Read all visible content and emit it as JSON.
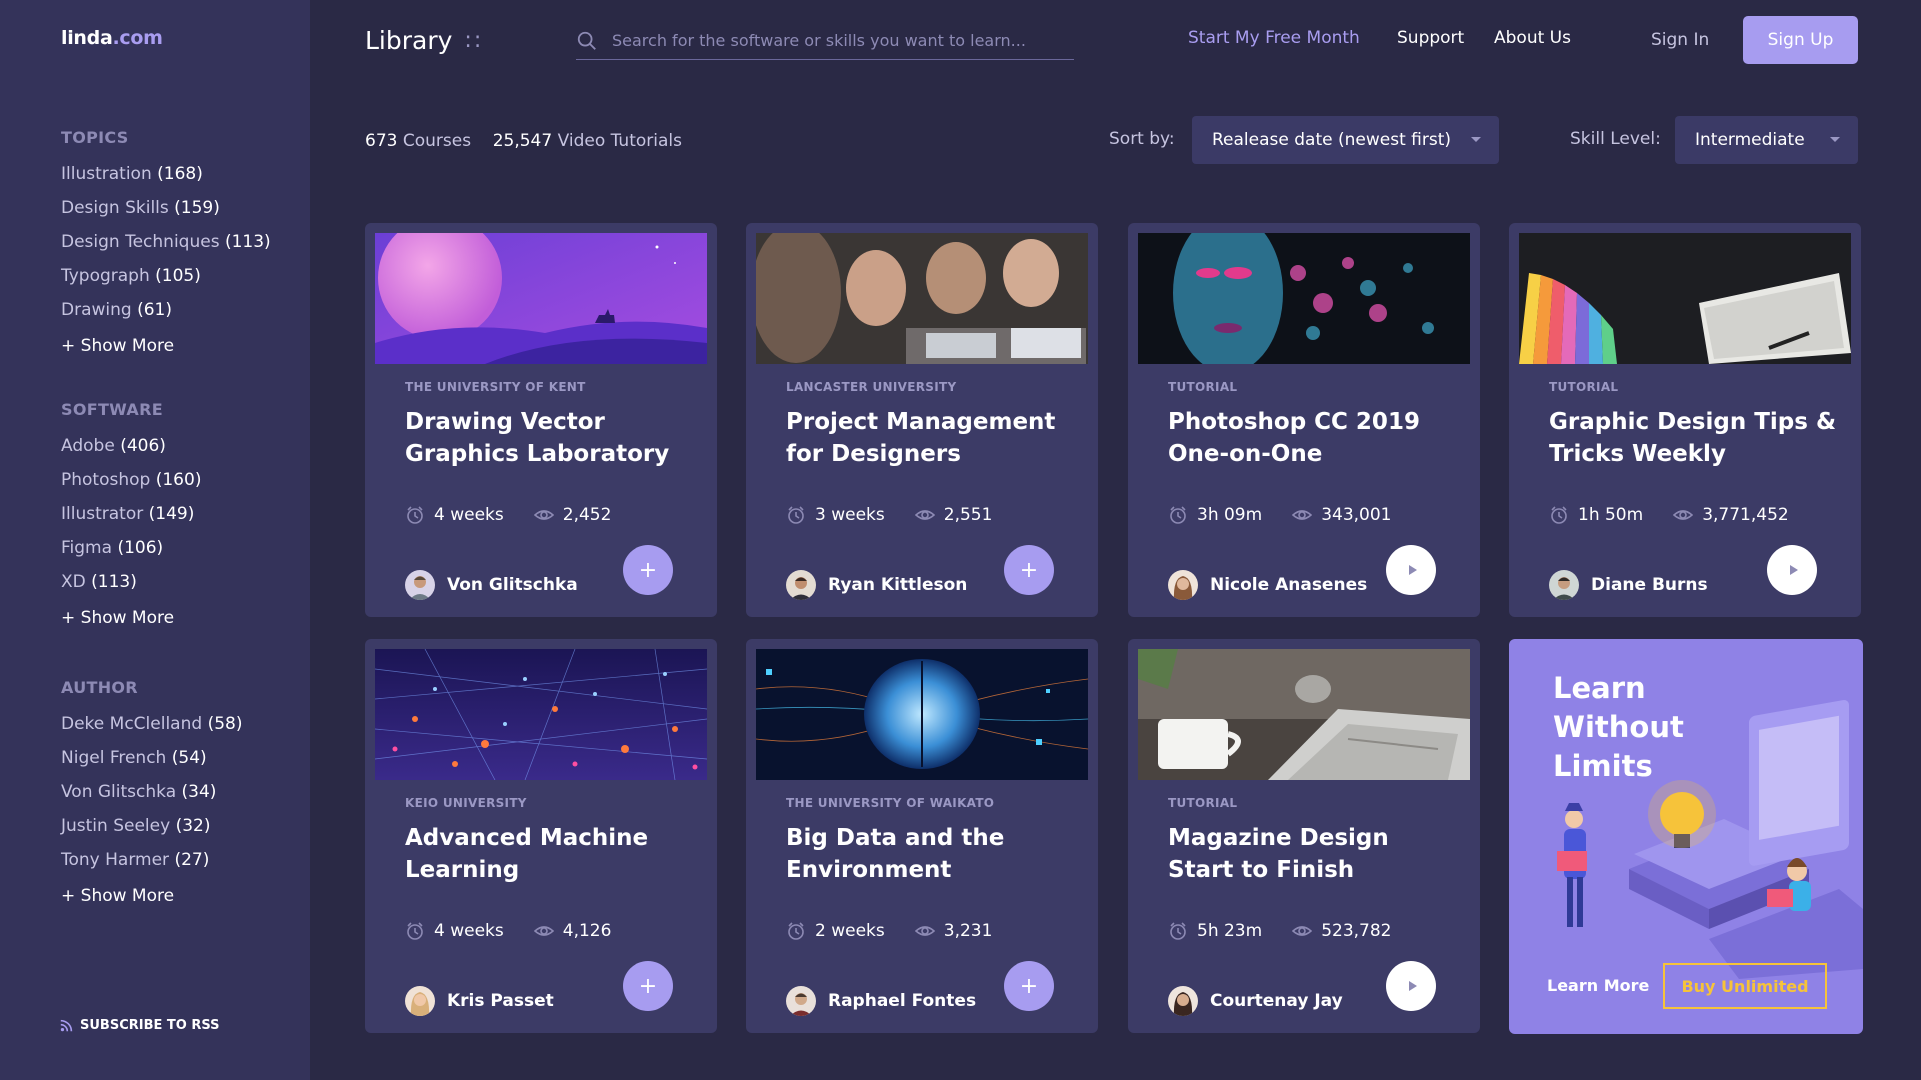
{
  "brand": {
    "name": "linda",
    "suffix": ".com"
  },
  "header": {
    "title": "Library",
    "title_icon": "::",
    "search_placeholder": "Search for the software or skills you want to learn...",
    "nav": [
      "Start My Free Month",
      "Support",
      "About Us",
      "Sign In"
    ],
    "signup": "Sign Up"
  },
  "sidebar": {
    "topics": {
      "heading": "TOPICS",
      "items": [
        {
          "label": "Illustration",
          "count": "(168)"
        },
        {
          "label": "Design Skills",
          "count": "(159)"
        },
        {
          "label": "Design Techniques",
          "count": "(113)"
        },
        {
          "label": "Typograph",
          "count": "(105)"
        },
        {
          "label": "Drawing",
          "count": "(61)"
        }
      ],
      "more": "+ Show More"
    },
    "software": {
      "heading": "SOFTWARE",
      "items": [
        {
          "label": "Adobe",
          "count": "(406)"
        },
        {
          "label": "Photoshop",
          "count": "(160)"
        },
        {
          "label": "Illustrator",
          "count": "(149)"
        },
        {
          "label": "Figma",
          "count": "(106)"
        },
        {
          "label": "XD",
          "count": "(113)"
        }
      ],
      "more": "+ Show More"
    },
    "author": {
      "heading": "AUTHOR",
      "items": [
        {
          "label": "Deke McClelland",
          "count": "(58)"
        },
        {
          "label": "Nigel French",
          "count": "(54)"
        },
        {
          "label": "Von Glitschka",
          "count": "(34)"
        },
        {
          "label": "Justin Seeley",
          "count": "(32)"
        },
        {
          "label": "Tony Harmer",
          "count": "(27)"
        }
      ],
      "more": "+ Show More"
    },
    "rss": "SUBSCRIBE TO RSS"
  },
  "filters": {
    "courses_count": "673",
    "courses_label": "Courses",
    "videos_count": "25,547",
    "videos_label": "Video Tutorials",
    "sort_label": "Sort by:",
    "sort_value": "Realease date (newest first)",
    "skill_label": "Skill Level:",
    "skill_value": "Intermediate"
  },
  "cards": [
    {
      "label": "THE UNIVERSITY OF KENT",
      "title": "Drawing Vector Graphics Laboratory",
      "duration": "4 weeks",
      "views": "2,452",
      "author": "Von Glitschka",
      "action": "plus",
      "thumb": "desert-moon"
    },
    {
      "label": "LANCASTER UNIVERSITY",
      "title": "Project Management for Designers",
      "duration": "3 weeks",
      "views": "2,551",
      "author": "Ryan Kittleson",
      "action": "plus",
      "thumb": "team-laptop"
    },
    {
      "label": "TUTORIAL",
      "title": "Photoshop CC 2019 One-on-One",
      "duration": "3h 09m",
      "views": "343,001",
      "author": "Nicole Anasenes",
      "action": "play",
      "thumb": "neon-face"
    },
    {
      "label": "TUTORIAL",
      "title": "Graphic Design Tips & Tricks Weekly",
      "duration": "1h 50m",
      "views": "3,771,452",
      "author": "Diane Burns",
      "action": "play",
      "thumb": "swatches-tablet"
    },
    {
      "label": "KEIO UNIVERSITY",
      "title": "Advanced Machine Learning",
      "duration": "4 weeks",
      "views": "4,126",
      "author": "Kris Passet",
      "action": "plus",
      "thumb": "particle-network"
    },
    {
      "label": "THE UNIVERSITY OF WAIKATO",
      "title": "Big Data and the Environment",
      "duration": "2 weeks",
      "views": "3,231",
      "author": "Raphael Fontes",
      "action": "plus",
      "thumb": "digital-brain"
    },
    {
      "label": "TUTORIAL",
      "title": "Magazine Design Start to Finish",
      "duration": "5h 23m",
      "views": "523,782",
      "author": "Courtenay Jay",
      "action": "play",
      "thumb": "magazines-cup"
    }
  ],
  "promo": {
    "title": "Learn Without Limits",
    "learn_more": "Learn More",
    "buy": "Buy Unlimited"
  },
  "colors": {
    "background": "#2a2945",
    "sidebar": "#34335a",
    "card": "#3c3b66",
    "accent": "#a79cf0",
    "promo": "#8f82e6",
    "promo_button": "#f6c33a"
  }
}
